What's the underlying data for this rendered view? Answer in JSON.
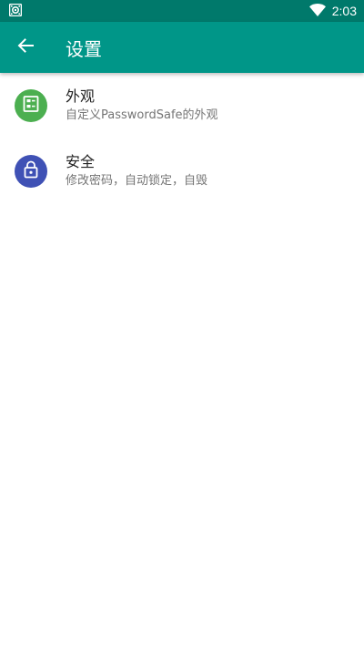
{
  "status_bar": {
    "time": "2:03",
    "notification_icon": "passwordsafe-notification-icon",
    "wifi_icon": "wifi-icon",
    "background": "#00796b"
  },
  "app_bar": {
    "title": "设置",
    "back_icon": "arrow-back-icon",
    "background": "#009688"
  },
  "settings": {
    "items": [
      {
        "title": "外观",
        "summary": "自定义PasswordSafe的外观",
        "icon": "appearance-icon",
        "icon_color": "#4caf50"
      },
      {
        "title": "安全",
        "summary": "修改密码，自动锁定，自毁",
        "icon": "lock-icon",
        "icon_color": "#3f51b5"
      }
    ]
  }
}
